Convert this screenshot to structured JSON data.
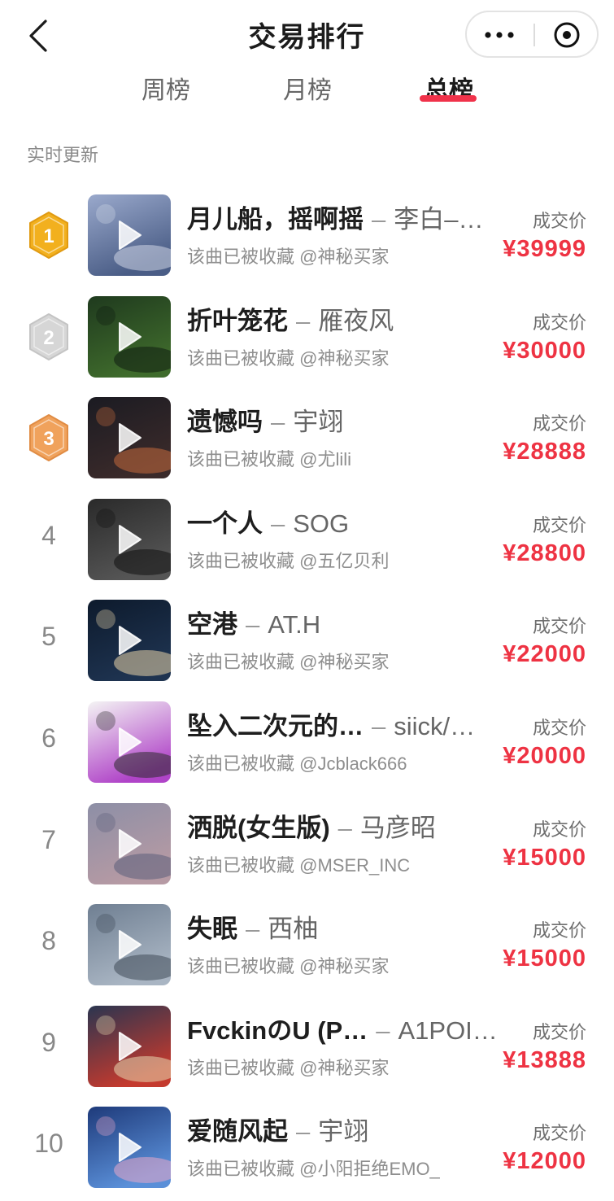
{
  "header": {
    "title": "交易排行",
    "back_icon": "chevron-left-icon",
    "more_icon": "more-dots-icon",
    "close_icon": "target-close-icon"
  },
  "tabs": [
    {
      "label": "周榜",
      "active": false
    },
    {
      "label": "月榜",
      "active": false
    },
    {
      "label": "总榜",
      "active": true
    }
  ],
  "realtime_label": "实时更新",
  "colors": {
    "accent": "#f0324a",
    "price": "#ee3343",
    "gold": "#f2b01e",
    "silver": "#d6d6d6",
    "bronze": "#f0a25c"
  },
  "list": {
    "price_label": "成交价",
    "items": [
      {
        "rank": "1",
        "title": "月儿船，摇啊摇",
        "sep": "–",
        "artist": "李白–…",
        "owner": "该曲已被收藏 @神秘买家",
        "price": "¥39999",
        "cover": [
          "#9aa9cc",
          "#4a5d86",
          "#cfd6e6"
        ]
      },
      {
        "rank": "2",
        "title": "折叶笼花",
        "sep": "–",
        "artist": "雁夜风",
        "owner": "该曲已被收藏 @神秘买家",
        "price": "¥30000",
        "cover": [
          "#1f3a1e",
          "#3f6b2c",
          "#0f1c10"
        ]
      },
      {
        "rank": "3",
        "title": "遗憾吗",
        "sep": "–",
        "artist": "宇翊",
        "owner": "该曲已被收藏 @尤lili",
        "price": "¥28888",
        "cover": [
          "#1b1b22",
          "#3a2a2a",
          "#c46a3c"
        ]
      },
      {
        "rank": "4",
        "title": "一个人",
        "sep": "–",
        "artist": "SOG",
        "owner": "该曲已被收藏 @五亿贝利",
        "price": "¥28800",
        "cover": [
          "#2a2a2a",
          "#555555",
          "#111111"
        ]
      },
      {
        "rank": "5",
        "title": "空港",
        "sep": "–",
        "artist": "AT.H",
        "owner": "该曲已被收藏 @神秘买家",
        "price": "¥22000",
        "cover": [
          "#0d1a2c",
          "#1e3350",
          "#e9d3a8"
        ]
      },
      {
        "rank": "6",
        "title": "坠入二次元的…",
        "sep": "–",
        "artist": "siick/…",
        "owner": "该曲已被收藏 @Jcblack666",
        "price": "¥20000",
        "cover": [
          "#f4f4f4",
          "#b044c8",
          "#2b2b2b"
        ]
      },
      {
        "rank": "7",
        "title": "洒脱(女生版)",
        "sep": "–",
        "artist": "马彦昭",
        "owner": "该曲已被收藏 @MSER_INC",
        "price": "¥15000",
        "cover": [
          "#8d8fa6",
          "#b69aa4",
          "#5b5f7a"
        ]
      },
      {
        "rank": "8",
        "title": "失眠",
        "sep": "–",
        "artist": "西柚",
        "owner": "该曲已被收藏 @神秘买家",
        "price": "¥15000",
        "cover": [
          "#6f7f92",
          "#a9b5c3",
          "#3f4a58"
        ]
      },
      {
        "rank": "9",
        "title": "FvckinのU (P…",
        "sep": "–",
        "artist": "A1POI…",
        "owner": "该曲已被收藏 @神秘买家",
        "price": "¥13888",
        "cover": [
          "#2a3550",
          "#c43a2e",
          "#e8d9b0"
        ]
      },
      {
        "rank": "10",
        "title": "爱随风起",
        "sep": "–",
        "artist": "宇翊",
        "owner": "该曲已被收藏 @小阳拒绝EMO_",
        "price": "¥12000",
        "cover": [
          "#1e3a7a",
          "#5a8fd8",
          "#e9a7c8"
        ]
      }
    ]
  }
}
